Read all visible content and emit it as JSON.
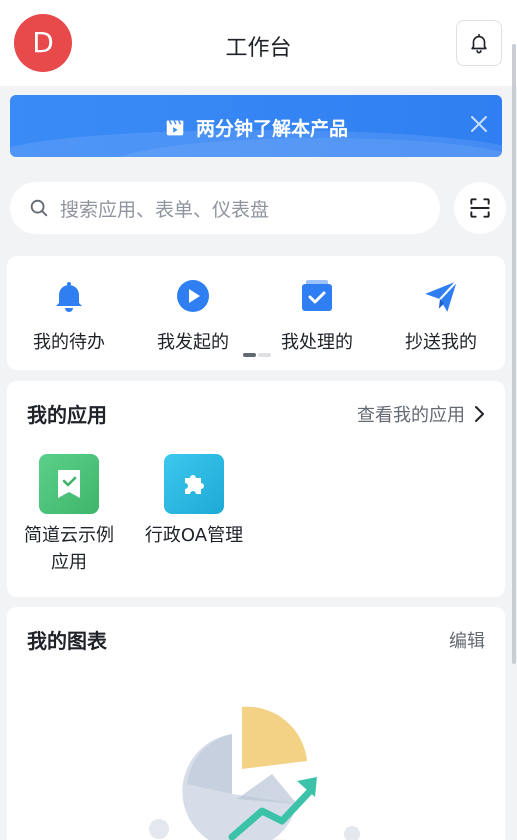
{
  "header": {
    "avatar_letter": "D",
    "title": "工作台",
    "bell_icon": "bell-icon"
  },
  "banner": {
    "text": "两分钟了解本产品",
    "icon": "video-icon",
    "close_icon": "close-icon"
  },
  "search": {
    "placeholder": "搜索应用、表单、仪表盘",
    "icon": "search-icon",
    "scan_icon": "scan-icon"
  },
  "quick_actions": [
    {
      "label": "我的待办",
      "icon": "bell-icon"
    },
    {
      "label": "我发起的",
      "icon": "play-icon"
    },
    {
      "label": "我处理的",
      "icon": "check-calendar-icon"
    },
    {
      "label": "抄送我的",
      "icon": "send-icon"
    }
  ],
  "my_apps": {
    "title": "我的应用",
    "view_all": "查看我的应用",
    "items": [
      {
        "name": "简道云示例应用",
        "color": "#4cc27a",
        "icon": "bookmark-check-icon"
      },
      {
        "name": "行政OA管理",
        "color": "#28b8e0",
        "icon": "puzzle-icon"
      }
    ]
  },
  "my_charts": {
    "title": "我的图表",
    "edit_label": "编辑",
    "illustration": "empty-chart-illustration"
  },
  "colors": {
    "primary": "#3370ff",
    "banner": "#3b8bf6",
    "avatar": "#e8494b",
    "page_bg": "#f2f3f5"
  }
}
